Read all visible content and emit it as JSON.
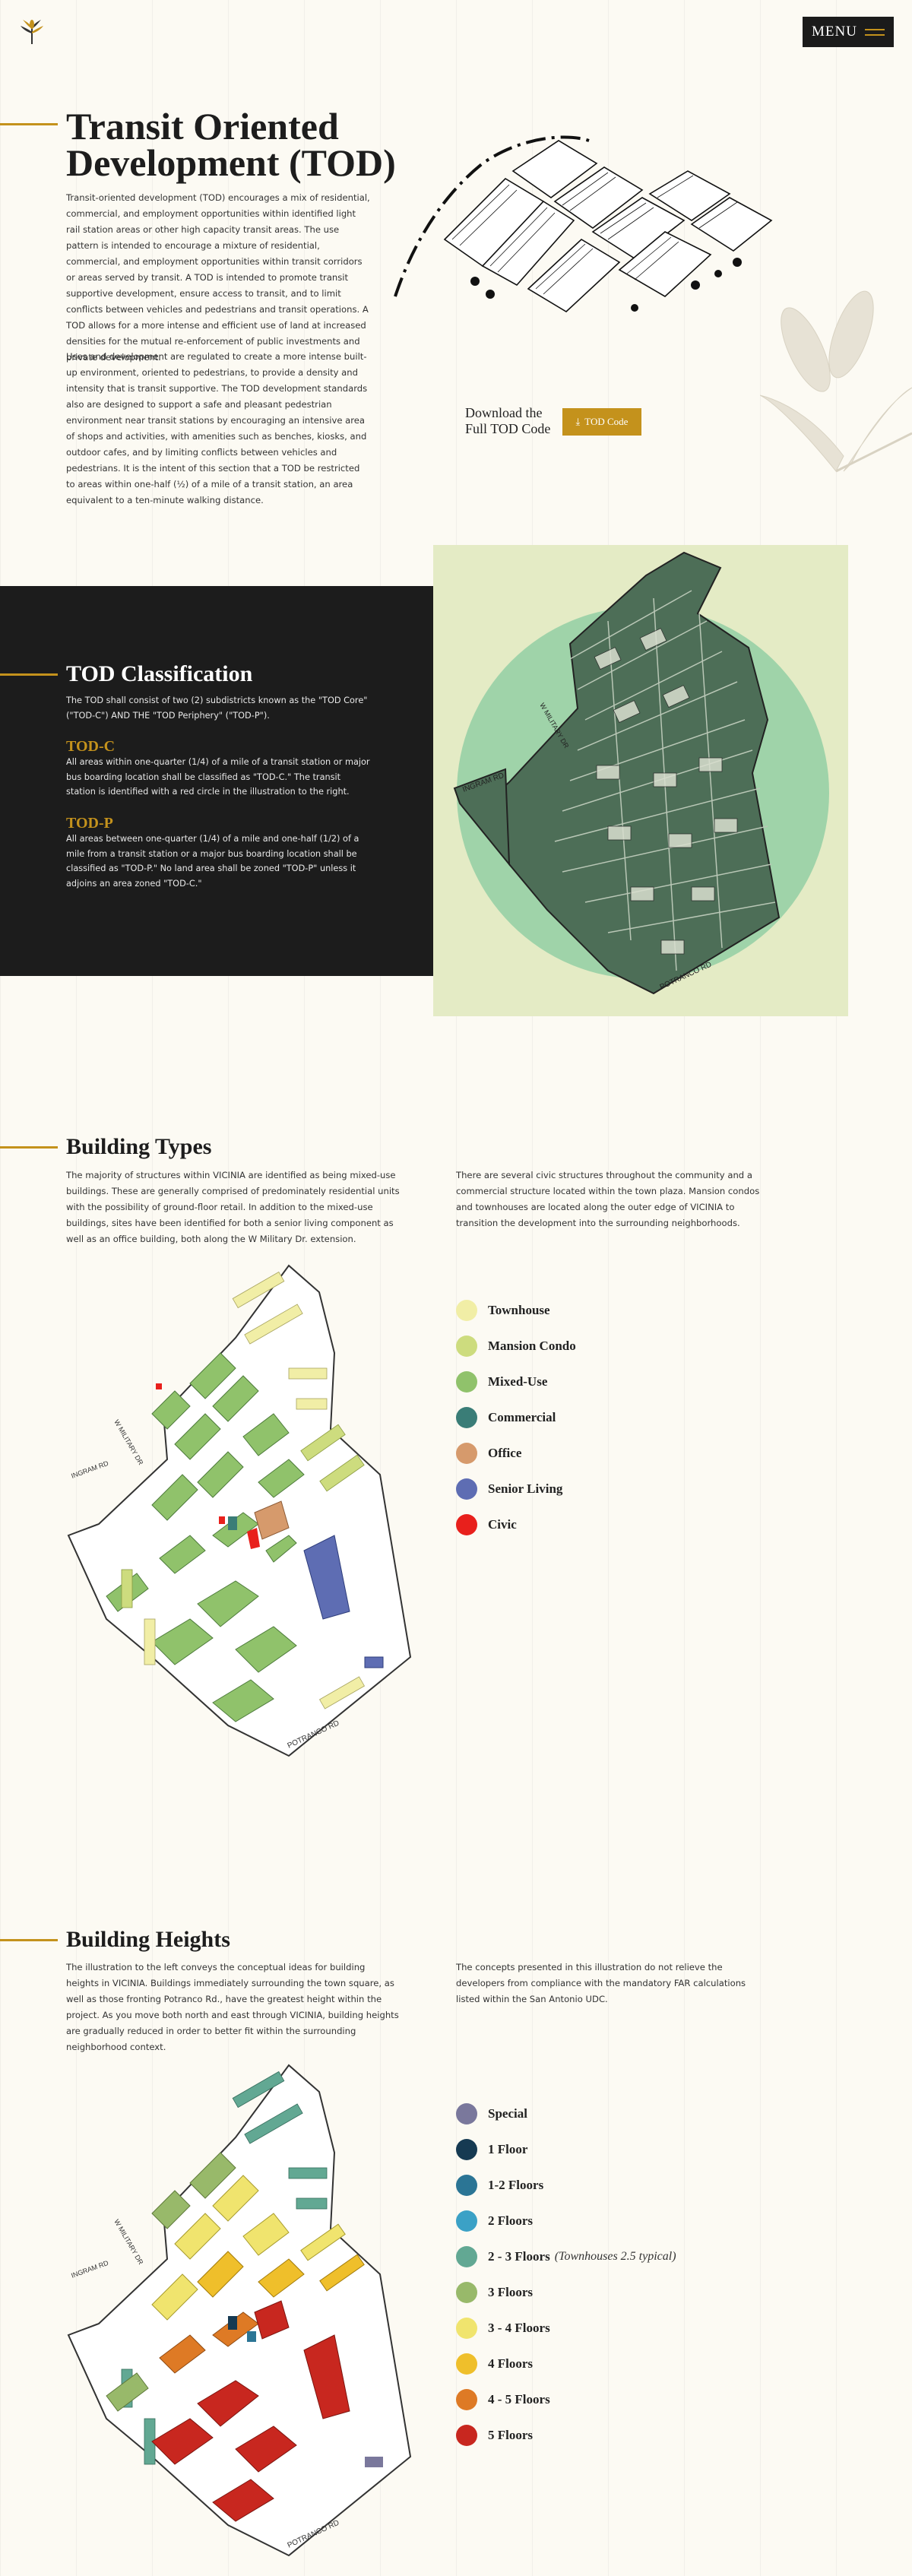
{
  "header": {
    "menu_label": "MENU"
  },
  "hero": {
    "title": "Transit Oriented Development (TOD)",
    "paragraph1": "Transit-oriented development (TOD) encourages a mix of residential, commercial, and employment opportunities within identified light rail station areas or other high capacity transit areas. The use pattern is intended to encourage a mixture of residential, commercial, and employment opportunities within transit corridors or areas served by transit. A TOD is intended to promote transit supportive development, ensure access to transit, and to limit conflicts between vehicles and pedestrians and transit operations. A TOD allows for a more intense and efficient use of land at increased densities for the mutual re-enforcement of public investments and private development.",
    "paragraph2": "Uses and development are regulated to create a more intense built-up environment, oriented to pedestrians, to provide a density and intensity that is transit supportive. The TOD development standards also are designed to support a safe and pleasant pedestrian environment near transit stations by encouraging an intensive area of shops and activities, with amenities such as benches, kiosks, and outdoor cafes, and by limiting conflicts between vehicles and pedestrians. It is the intent of this section that a TOD be restricted to areas within one-half (½) of a mile of a transit station, an area equivalent to a ten-minute walking distance.",
    "download_label": "Download the Full TOD Code",
    "download_button": "TOD Code"
  },
  "classification": {
    "title": "TOD Classification",
    "intro": "The TOD shall consist of two (2) subdistricts known as the \"TOD Core\" (\"TOD-C\") AND THE \"TOD Periphery\" (\"TOD-P\").",
    "todc_title": "TOD-C",
    "todc_text": "All areas within one-quarter (1/4) of a mile of a transit station or major bus boarding location shall be classified as \"TOD-C.\" The transit station is identified with a red circle in the illustration to the right.",
    "todp_title": "TOD-P",
    "todp_text": "All areas between one-quarter (1/4) of a mile and one-half (1/2) of a mile from a transit station or a major bus boarding location shall be classified as \"TOD-P.\" No land area shall be zoned \"TOD-P\" unless it adjoins an area zoned \"TOD-C.\"",
    "map_labels": {
      "road_a": "INGRAM RD",
      "road_b": "POTRANCO RD",
      "road_c": "W MILITARY DR"
    }
  },
  "building_types": {
    "title": "Building Types",
    "left_text": "The majority of structures within VICINIA are identified as being mixed-use buildings. These are generally comprised of predominately residential units with the possibility of ground-floor retail. In addition to the mixed-use buildings, sites have been identified for both a senior living component as well as an office building, both along the W Military Dr. extension.",
    "right_text": "There are several civic structures throughout the community and a commercial structure located within the town plaza. Mansion condos and townhouses are located along the outer edge of VICINIA to transition the development into the surrounding neighborhoods.",
    "legend": [
      {
        "label": "Townhouse",
        "color": "#f1eea6"
      },
      {
        "label": "Mansion Condo",
        "color": "#cddc7e"
      },
      {
        "label": "Mixed-Use",
        "color": "#90c26b"
      },
      {
        "label": "Commercial",
        "color": "#3a7d77"
      },
      {
        "label": "Office",
        "color": "#d69a6c"
      },
      {
        "label": "Senior Living",
        "color": "#5e6db3"
      },
      {
        "label": "Civic",
        "color": "#e8201c"
      }
    ]
  },
  "building_heights": {
    "title": "Building Heights",
    "left_text": "The illustration to the left conveys the conceptual ideas for building heights in VICINIA. Buildings immediately surrounding the town square, as well as those fronting Potranco Rd., have the greatest height within the project. As you move both north and east through VICINIA, building heights are gradually reduced in order to better fit within the surrounding neighborhood context.",
    "right_text": "The concepts presented in this illustration do not relieve the developers from compliance with the mandatory FAR calculations listed within the San Antonio UDC.",
    "legend": [
      {
        "label": "Special",
        "note": "",
        "color": "#7a789c"
      },
      {
        "label": "1 Floor",
        "note": "",
        "color": "#163a52"
      },
      {
        "label": "1-2 Floors",
        "note": "",
        "color": "#2b7595"
      },
      {
        "label": "2 Floors",
        "note": "",
        "color": "#3ba1c6"
      },
      {
        "label": "2 - 3 Floors",
        "note": "(Townhouses 2.5 typical)",
        "color": "#62a893"
      },
      {
        "label": "3 Floors",
        "note": "",
        "color": "#98b96a"
      },
      {
        "label": "3 - 4 Floors",
        "note": "",
        "color": "#f0e46e"
      },
      {
        "label": "4 Floors",
        "note": "",
        "color": "#efbf2b"
      },
      {
        "label": "4 - 5 Floors",
        "note": "",
        "color": "#de7a25"
      },
      {
        "label": "5 Floors",
        "note": "",
        "color": "#c8271f"
      }
    ]
  },
  "colors": {
    "accent": "#c4921c",
    "dark": "#1c1c1c",
    "background": "#fcfaf3"
  }
}
